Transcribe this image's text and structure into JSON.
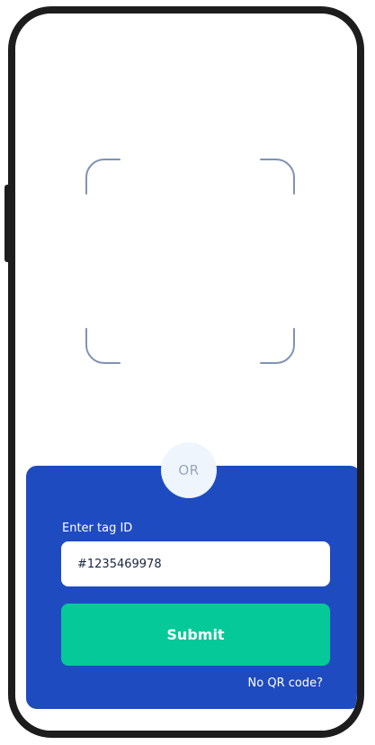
{
  "or_badge": {
    "label": "OR"
  },
  "form": {
    "label": "Enter tag ID",
    "tag_value": "#1235469978",
    "submit_label": "Submit",
    "no_qr_link": "No QR code?"
  },
  "colors": {
    "panel_bg": "#1f4bc0",
    "submit_bg": "#05c998",
    "badge_bg": "#eef5fd",
    "scan_frame": "#7f93b5",
    "phone_frame": "#1d1d1d"
  },
  "icons": {
    "scan_frame": "qr-scan-frame-icon"
  }
}
